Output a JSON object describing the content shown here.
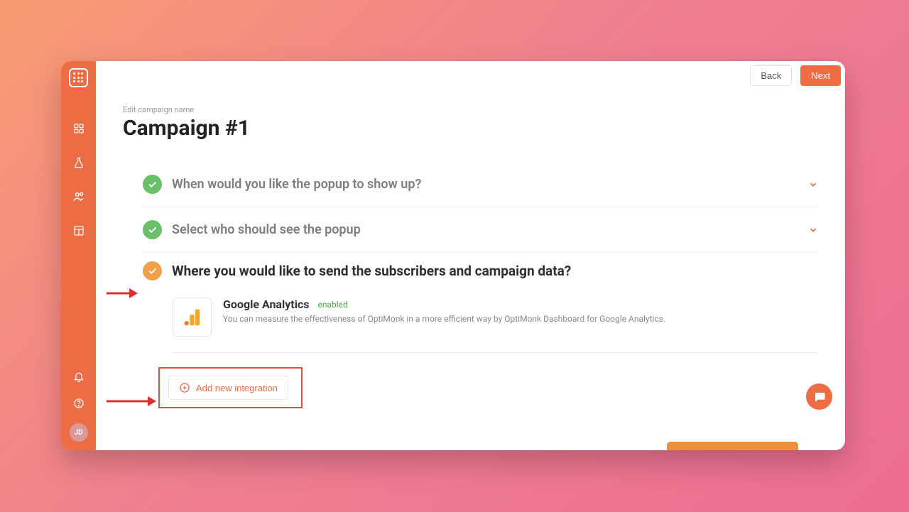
{
  "header": {
    "back_label": "Back",
    "next_label": "Next"
  },
  "page": {
    "edit_label": "Edit campaign name",
    "title": "Campaign #1"
  },
  "steps": {
    "when": "When would you like the popup to show up?",
    "who": "Select who should see the popup",
    "where": "Where you would like to send the subscribers and campaign data?"
  },
  "integration": {
    "name": "Google Analytics",
    "status": "enabled",
    "description": "You can measure the effectiveness of OptiMonk in a more efficient way by OptiMonk Dashboard for Google Analytics."
  },
  "actions": {
    "add_integration": "Add new integration"
  },
  "sidebar": {
    "avatar_initials": "JD"
  }
}
